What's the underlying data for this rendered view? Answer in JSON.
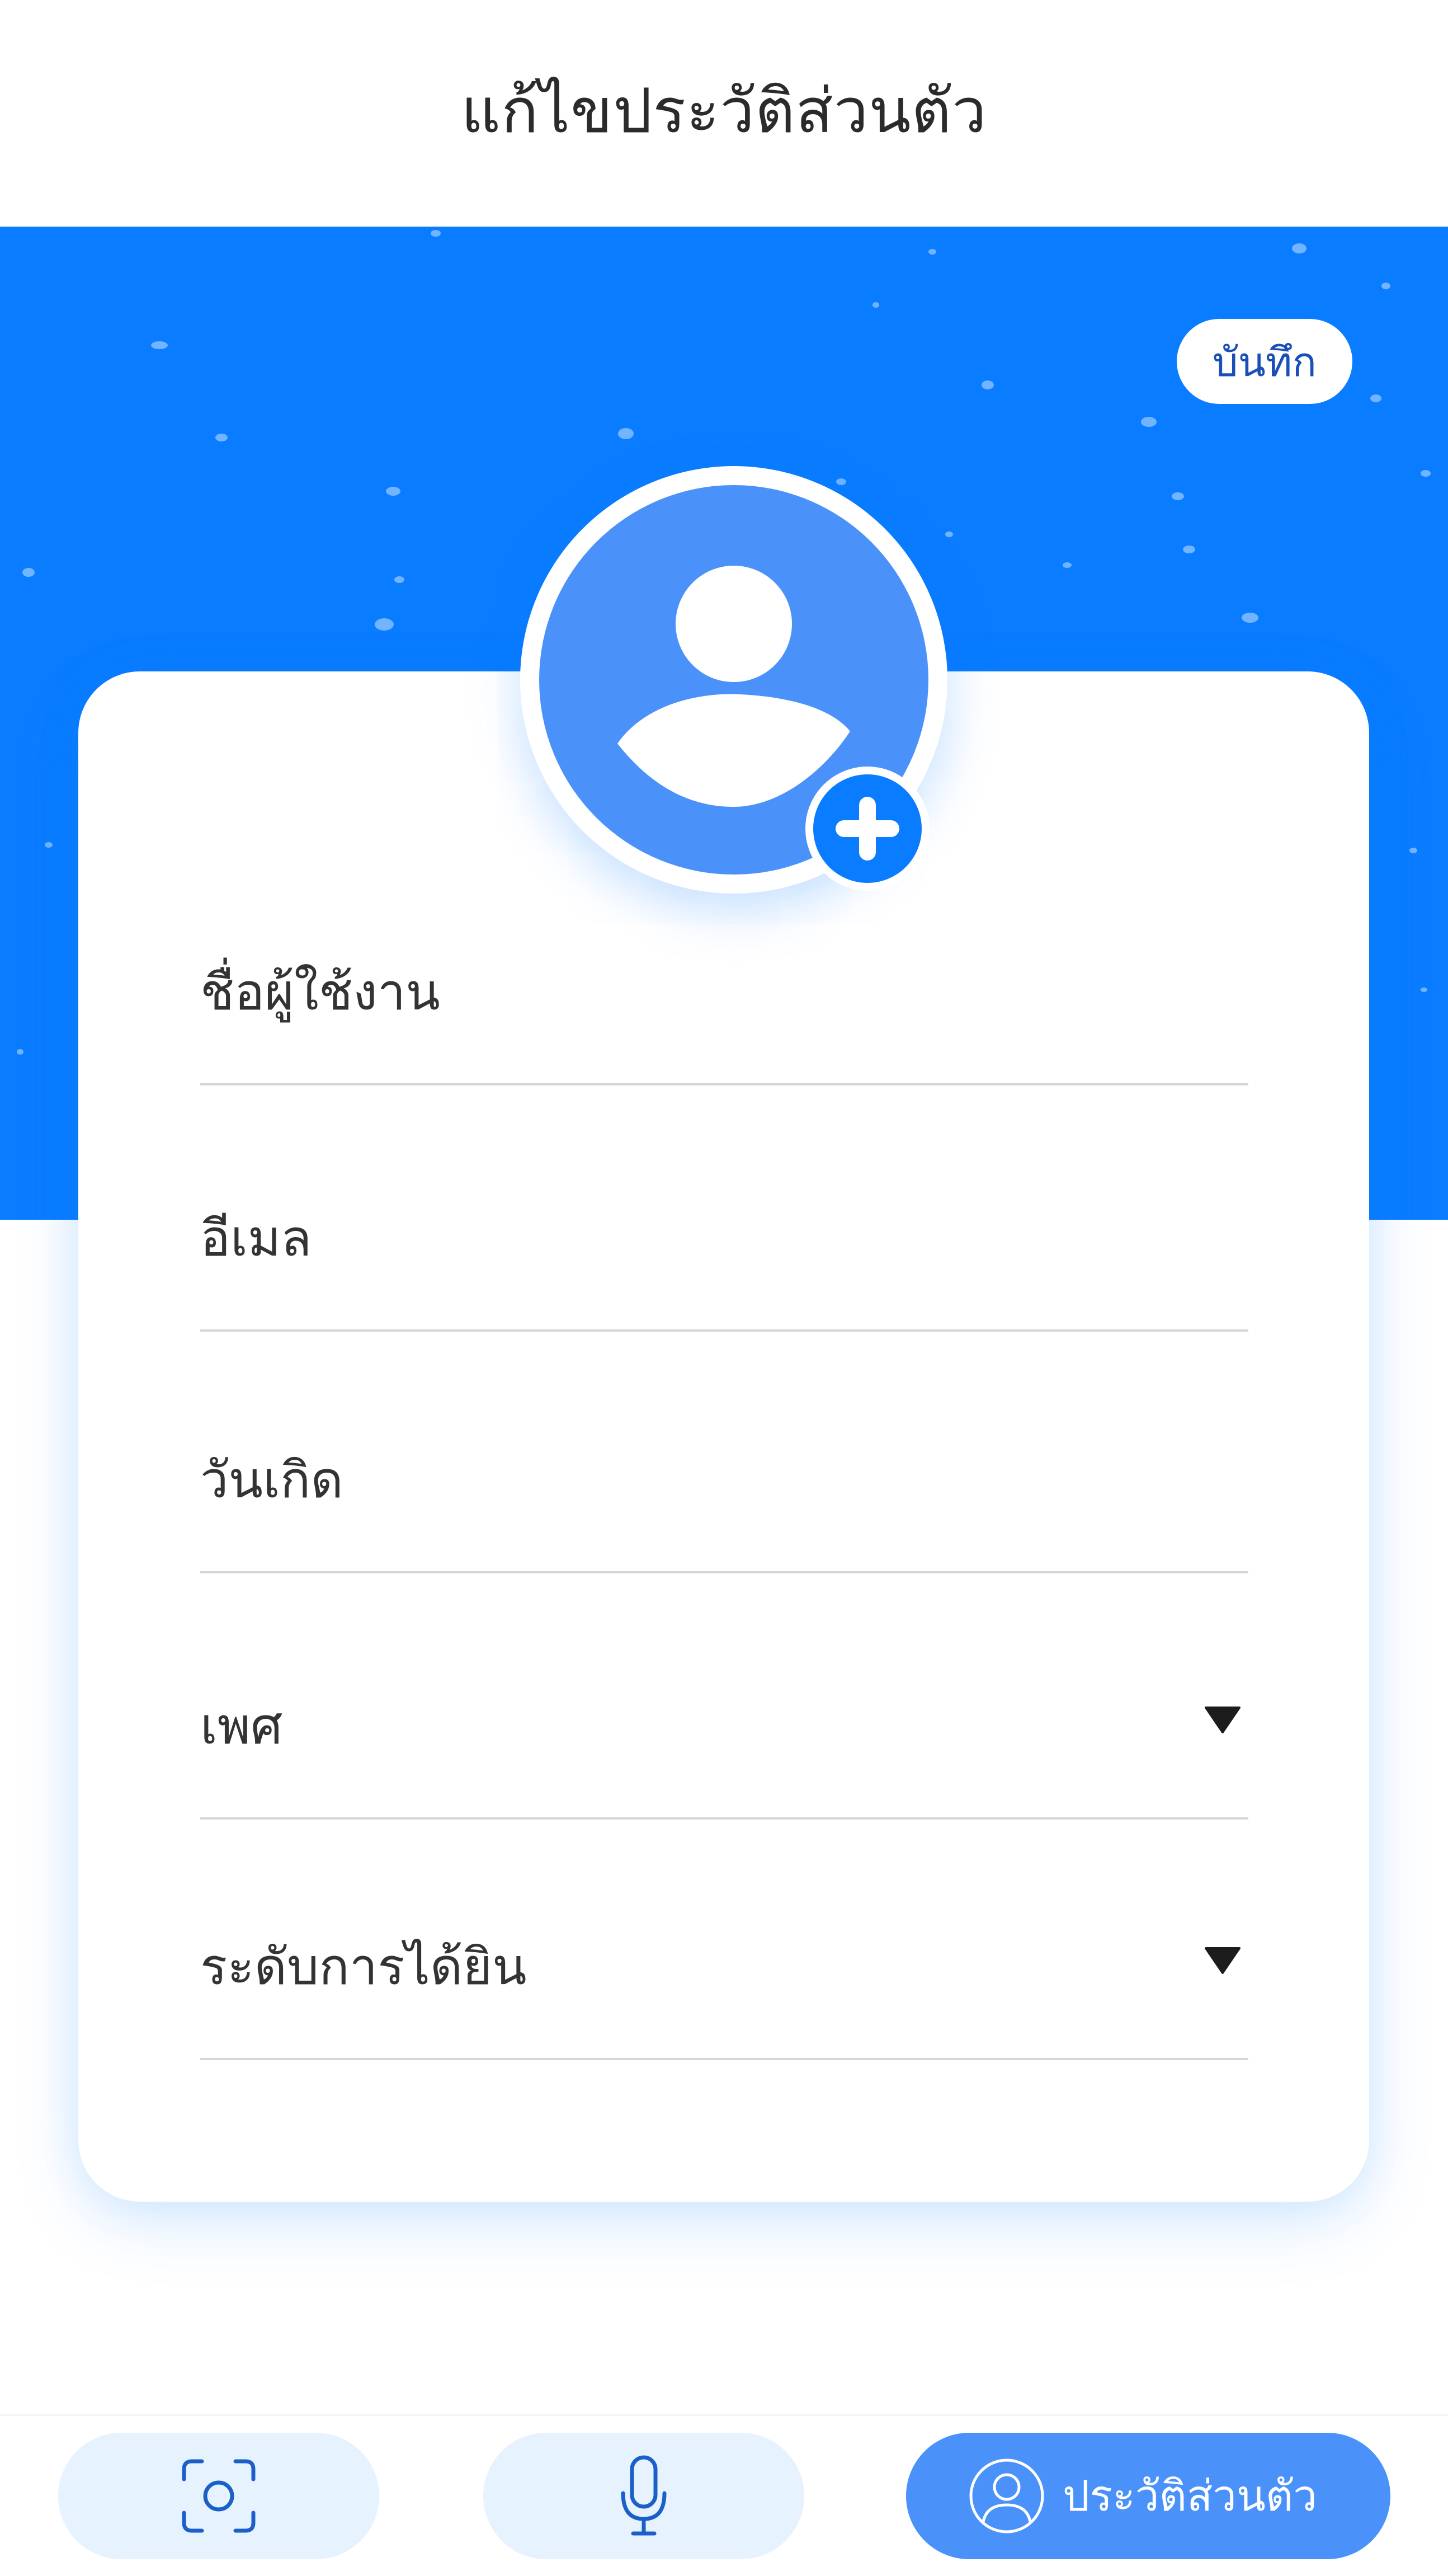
{
  "header": {
    "title": "แก้ไขประวัติส่วนตัว"
  },
  "hero": {
    "save_label": "บันทึก",
    "color": "#0a7cff"
  },
  "avatar": {
    "icon": "user-avatar-icon",
    "add_icon": "plus-icon"
  },
  "form": {
    "fields": [
      {
        "label": "ชื่อผู้ใช้งาน",
        "type": "text"
      },
      {
        "label": "อีเมล",
        "type": "email"
      },
      {
        "label": "วันเกิด",
        "type": "date"
      },
      {
        "label": "เพศ",
        "type": "select"
      },
      {
        "label": "ระดับการได้ยิน",
        "type": "select"
      }
    ]
  },
  "bottom_nav": {
    "items": [
      {
        "icon": "camera-scan-icon"
      },
      {
        "icon": "microphone-icon"
      },
      {
        "icon": "user-icon",
        "label": "ประวัติส่วนตัว",
        "active": true
      }
    ]
  },
  "colors": {
    "accent": "#0a7cff",
    "accent_light": "#4a92fa",
    "nav_pill": "#e7f2ff"
  }
}
